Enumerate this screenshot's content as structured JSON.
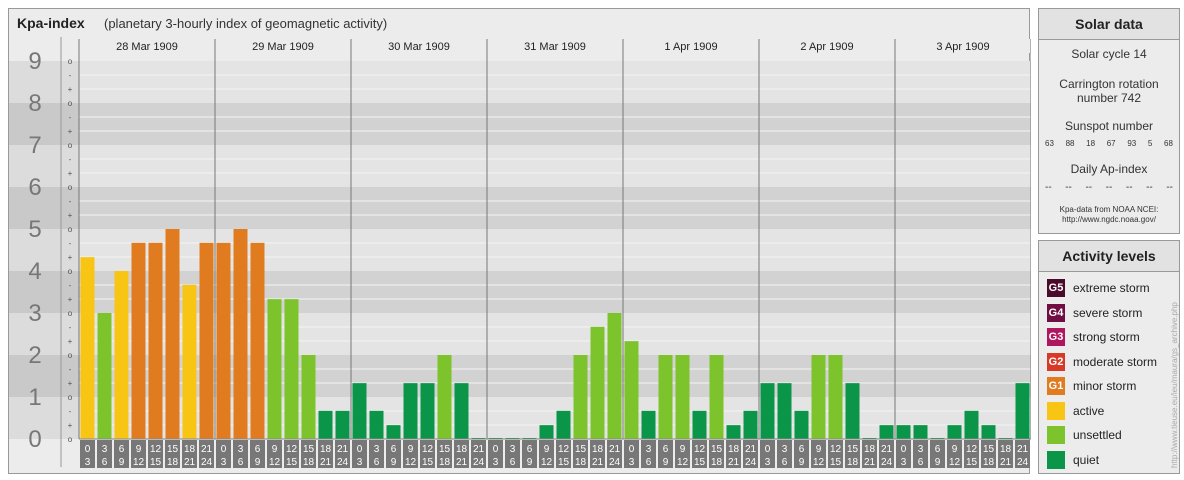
{
  "main": {
    "title": "Kpa-index",
    "subtitle": "(planetary 3-hourly index of geomagnetic activity)"
  },
  "chart_data": {
    "type": "bar",
    "ylim": [
      0,
      9
    ],
    "y_ticks": [
      "0",
      "1",
      "2",
      "3",
      "4",
      "5",
      "6",
      "7",
      "8",
      "9"
    ],
    "minor_ticks": [
      "o",
      "+",
      "-"
    ],
    "days": [
      "28 Mar 1909",
      "29 Mar 1909",
      "30 Mar 1909",
      "31 Mar 1909",
      "1 Apr 1909",
      "2 Apr 1909",
      "3 Apr 1909"
    ],
    "hour_start": [
      "0",
      "3",
      "6",
      "9",
      "12",
      "15",
      "18",
      "21"
    ],
    "hour_end": [
      "3",
      "6",
      "9",
      "12",
      "15",
      "18",
      "21",
      "24"
    ],
    "values": [
      [
        4.33,
        3.0,
        4.0,
        4.67,
        4.67,
        5.0,
        3.67,
        4.67
      ],
      [
        4.67,
        5.0,
        4.67,
        3.33,
        3.33,
        2.0,
        0.67,
        0.67
      ],
      [
        1.33,
        0.67,
        0.33,
        1.33,
        1.33,
        2.0,
        1.33,
        0.0
      ],
      [
        0.0,
        0.0,
        0.0,
        0.33,
        0.67,
        2.0,
        2.67,
        3.0
      ],
      [
        2.33,
        0.67,
        2.0,
        2.0,
        0.67,
        2.0,
        0.33,
        0.67
      ],
      [
        1.33,
        1.33,
        0.67,
        2.0,
        2.0,
        1.33,
        0.0,
        0.33
      ],
      [
        0.33,
        0.33,
        0.0,
        0.33,
        0.67,
        0.33,
        0.0,
        1.33
      ]
    ]
  },
  "solar": {
    "header": "Solar data",
    "solar_cycle": "Solar cycle 14",
    "carrington_line1": "Carrington rotation",
    "carrington_line2": "number 742",
    "sunspot_title": "Sunspot number",
    "sunspots": [
      "63",
      "88",
      "18",
      "67",
      "93",
      "5",
      "68"
    ],
    "ap_title": "Daily Ap-index",
    "ap_values": [
      "--",
      "--",
      "--",
      "--",
      "--",
      "--",
      "--"
    ],
    "credit_line1": "Kpa-data from NOAA NCEI:",
    "credit_line2": "http://www.ngdc.noaa.gov/"
  },
  "activity": {
    "header": "Activity levels",
    "levels": [
      {
        "badge": "G5",
        "label": "extreme storm",
        "color": "#4a0a2b"
      },
      {
        "badge": "G4",
        "label": "severe storm",
        "color": "#700d43"
      },
      {
        "badge": "G3",
        "label": "strong storm",
        "color": "#b0155f"
      },
      {
        "badge": "G2",
        "label": "moderate storm",
        "color": "#d83a27"
      },
      {
        "badge": "G1",
        "label": "minor storm",
        "color": "#e07b20"
      },
      {
        "badge": "",
        "label": "active",
        "color": "#f8c515"
      },
      {
        "badge": "",
        "label": "unsettled",
        "color": "#7cc32c"
      },
      {
        "badge": "",
        "label": "quiet",
        "color": "#0a9549"
      }
    ]
  },
  "side_credit": "http://www.tieuse.eu/ieu/maura/gs_archive.php"
}
